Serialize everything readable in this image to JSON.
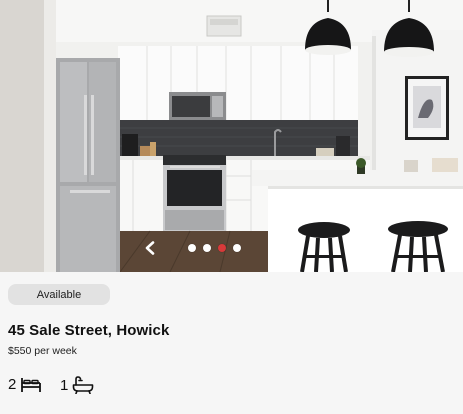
{
  "listing": {
    "status": "Available",
    "address": "45 Sale Street, Howick",
    "price": "$550 per week",
    "bedrooms": "2",
    "bathrooms": "1"
  },
  "gallery": {
    "total_slides": 4,
    "active_slide": 3,
    "image_subject": "kitchen-interior",
    "active_dot_color": "#d83a3a",
    "prev_icon": "chevron-left-icon",
    "next_icon": "chevron-right-icon"
  },
  "icons": {
    "bedrooms": "bed-icon",
    "bathrooms": "bathtub-icon"
  }
}
